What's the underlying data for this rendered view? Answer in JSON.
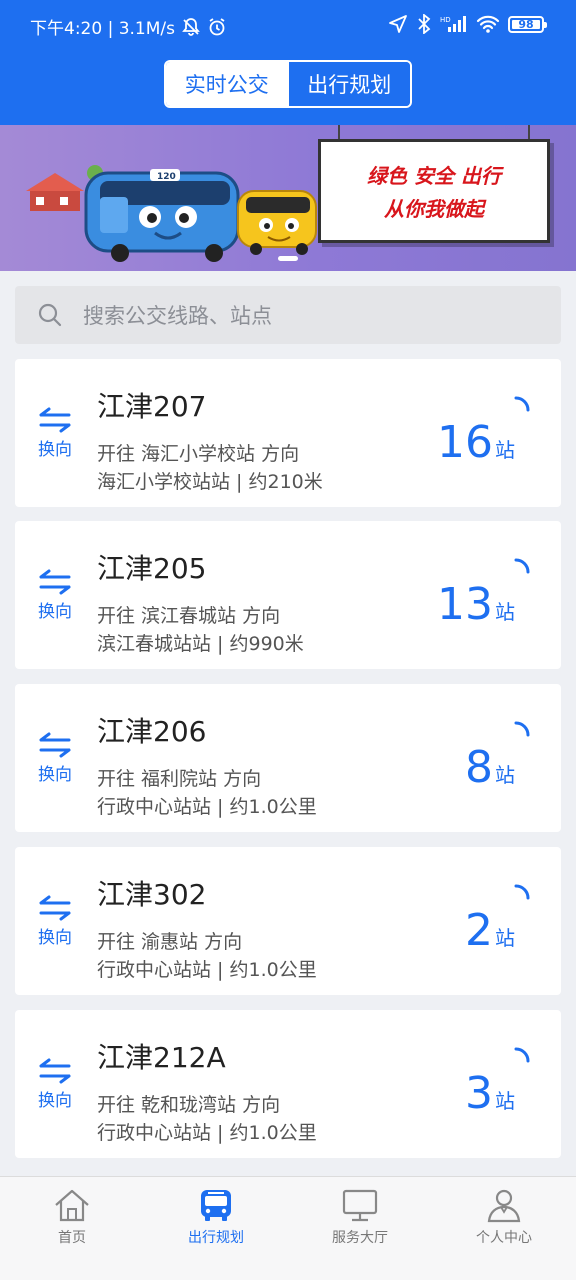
{
  "status_bar": {
    "time_speed": "下午4:20 | 3.1M/s",
    "battery": "98",
    "hd_label": "HD"
  },
  "header": {
    "tabs": [
      {
        "label": "实时公交",
        "active": true
      },
      {
        "label": "出行规划",
        "active": false
      }
    ]
  },
  "banner": {
    "line1": "绿色 安全 出行",
    "line2": "从你我做起",
    "bus_number": "120"
  },
  "search": {
    "placeholder": "搜索公交线路、站点"
  },
  "swap_label": "换向",
  "routes": [
    {
      "name": "江津207",
      "direction": "开往 海汇小学校站 方向",
      "nearest": "海汇小学校站站 | 约210米",
      "stops": "16",
      "stops_unit": "站"
    },
    {
      "name": "江津205",
      "direction": "开往 滨江春城站 方向",
      "nearest": "滨江春城站站 | 约990米",
      "stops": "13",
      "stops_unit": "站"
    },
    {
      "name": "江津206",
      "direction": "开往 福利院站 方向",
      "nearest": "行政中心站站 | 约1.0公里",
      "stops": "8",
      "stops_unit": "站"
    },
    {
      "name": "江津302",
      "direction": "开往 渝惠站 方向",
      "nearest": "行政中心站站 | 约1.0公里",
      "stops": "2",
      "stops_unit": "站"
    },
    {
      "name": "江津212A",
      "direction": "开往 乾和珑湾站 方向",
      "nearest": "行政中心站站 | 约1.0公里",
      "stops": "3",
      "stops_unit": "站"
    }
  ],
  "bottom_nav": [
    {
      "label": "首页",
      "icon": "home-icon",
      "active": false
    },
    {
      "label": "出行规划",
      "icon": "bus-icon",
      "active": true
    },
    {
      "label": "服务大厅",
      "icon": "monitor-icon",
      "active": false
    },
    {
      "label": "个人中心",
      "icon": "user-icon",
      "active": false
    }
  ],
  "colors": {
    "primary": "#1e6ff0",
    "banner_text": "#d8161c"
  }
}
